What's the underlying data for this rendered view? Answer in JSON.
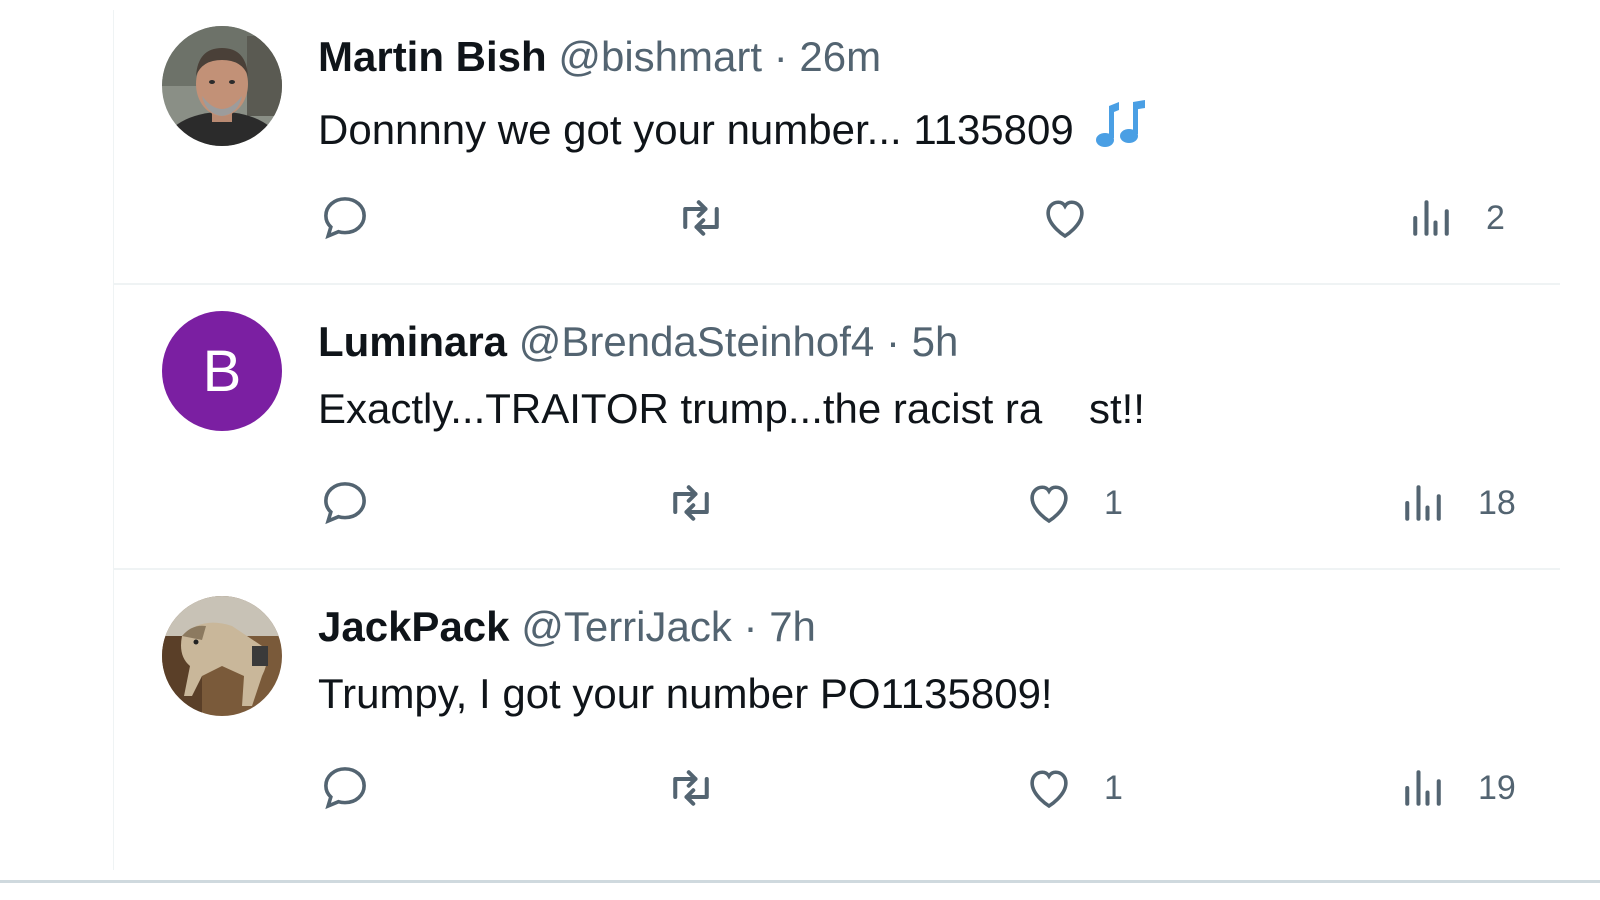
{
  "tweets": [
    {
      "name": "Martin Bish",
      "handle": "@bishmart",
      "separator": "·",
      "time": "26m",
      "text": "Donnnny we got your number... 1135809",
      "emoji": "music-notes-icon",
      "likes": "",
      "views": "2",
      "avatar": "photo"
    },
    {
      "name": "Luminara",
      "handle": "@BrendaSteinhof4",
      "separator": "·",
      "time": "5h",
      "text": "Exactly...TRAITOR trump...the racist ra    st!!",
      "likes": "1",
      "views": "18",
      "avatar_letter": "B",
      "avatar_color": "#7b1fa2"
    },
    {
      "name": "JackPack",
      "handle": "@TerriJack",
      "separator": "·",
      "time": "7h",
      "text": "Trumpy, I got your number PO1135809!",
      "likes": "1",
      "views": "19",
      "avatar": "horse-photo"
    }
  ],
  "colors": {
    "text": "#0f1419",
    "secondary": "#536471",
    "divider": "#eff3f4",
    "accent": "#1d9bf0"
  }
}
